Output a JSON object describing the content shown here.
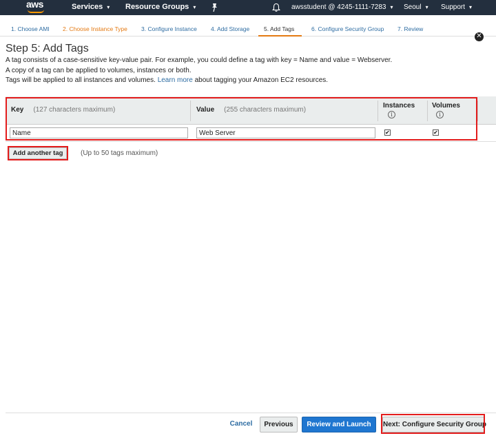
{
  "nav": {
    "logo": "aws",
    "services": "Services",
    "resource_groups": "Resource Groups",
    "account": "awsstudent @ 4245-1111-7283",
    "region": "Seoul",
    "support": "Support"
  },
  "steps": [
    {
      "label": "1. Choose AMI",
      "state": "link"
    },
    {
      "label": "2. Choose Instance Type",
      "state": "done"
    },
    {
      "label": "3. Configure Instance",
      "state": "link"
    },
    {
      "label": "4. Add Storage",
      "state": "link"
    },
    {
      "label": "5. Add Tags",
      "state": "active"
    },
    {
      "label": "6. Configure Security Group",
      "state": "link"
    },
    {
      "label": "7. Review",
      "state": "link"
    }
  ],
  "page": {
    "title": "Step 5: Add Tags",
    "line1": "A tag consists of a case-sensitive key-value pair. For example, you could define a tag with key = Name and value = Webserver.",
    "line2": "A copy of a tag can be applied to volumes, instances or both.",
    "line3_pre": "Tags will be applied to all instances and volumes.",
    "learn_more": "Learn more",
    "line3_post": "about tagging your Amazon EC2 resources."
  },
  "table": {
    "key_header": "Key",
    "key_hint": "(127 characters maximum)",
    "value_header": "Value",
    "value_hint": "(255 characters maximum)",
    "instances_header": "Instances",
    "volumes_header": "Volumes",
    "info_glyph": "i",
    "rows": [
      {
        "key": "Name",
        "value": "Web Server",
        "instances": true,
        "volumes": true
      }
    ]
  },
  "add_tag": {
    "label": "Add another tag",
    "hint": "(Up to 50 tags maximum)"
  },
  "footer": {
    "cancel": "Cancel",
    "previous": "Previous",
    "review": "Review and Launch",
    "next": "Next: Configure Security Group"
  },
  "colors": {
    "nav_bg": "#232f3e",
    "accent_orange": "#e47911",
    "link_blue": "#2d6ca2",
    "primary_blue": "#1f76d0",
    "highlight_red": "#e31b1b"
  },
  "icons": {
    "pin": "pin-icon",
    "bell": "bell-icon",
    "info": "info-icon",
    "remove": "remove-circle-icon",
    "caret": "chevron-down-icon"
  }
}
